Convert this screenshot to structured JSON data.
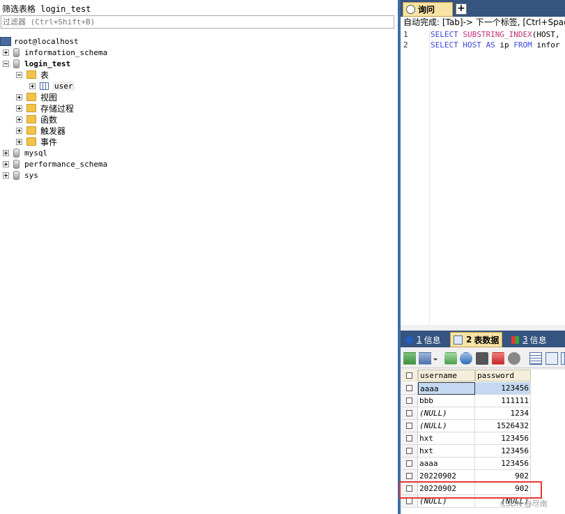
{
  "left_panel": {
    "title": "筛选表格 login_test",
    "filter_placeholder": "过滤器 (Ctrl+Shift+B)",
    "tree": {
      "root": "root@localhost",
      "databases": [
        "information_schema",
        "login_test",
        "mysql",
        "performance_schema",
        "sys"
      ],
      "login_test_children": [
        "表",
        "视图",
        "存储过程",
        "函数",
        "触发器",
        "事件"
      ],
      "table_item": "user"
    }
  },
  "query_editor": {
    "tab_label": "询问",
    "new_tab": "+",
    "autocomplete_hint": "自动完成: [Tab]-> 下一个标签, [Ctrl+Space]",
    "lines": [
      {
        "num": "1",
        "parts": [
          [
            "kw",
            "SELECT "
          ],
          [
            "fn",
            "SUBSTRING_INDEX"
          ],
          [
            "",
            "(HOST,"
          ]
        ]
      },
      {
        "num": "2",
        "parts": [
          [
            "kw",
            "SELECT "
          ],
          [
            "kw",
            "HOST "
          ],
          [
            "kw",
            "AS "
          ],
          [
            "",
            "ip "
          ],
          [
            "kw",
            "FROM "
          ],
          [
            "",
            "infor"
          ]
        ]
      }
    ]
  },
  "result_tabs": [
    {
      "num": "1",
      "label": "信息"
    },
    {
      "num": "2",
      "label": "表数据"
    },
    {
      "num": "3",
      "label": "信息"
    }
  ],
  "grid": {
    "columns": [
      "username",
      "password"
    ],
    "rows": [
      {
        "username": "aaaa",
        "password": "123456"
      },
      {
        "username": "bbb",
        "password": "111111"
      },
      {
        "username": "(NULL)",
        "password": "1234"
      },
      {
        "username": "(NULL)",
        "password": "1526432"
      },
      {
        "username": "hxt",
        "password": "123456"
      },
      {
        "username": "hxt",
        "password": "123456"
      },
      {
        "username": "aaaa",
        "password": "123456"
      },
      {
        "username": "20220902",
        "password": "902"
      },
      {
        "username": "20220902",
        "password": "902"
      },
      {
        "username": "(NULL)",
        "password": "(NULL)"
      }
    ]
  },
  "watermark": "CSDN @尽南",
  "colors": {
    "tab_bar": "#35547f",
    "active_tab": "#f7e3a4",
    "highlight": "#e53935",
    "keyword": "#3b47d6"
  }
}
